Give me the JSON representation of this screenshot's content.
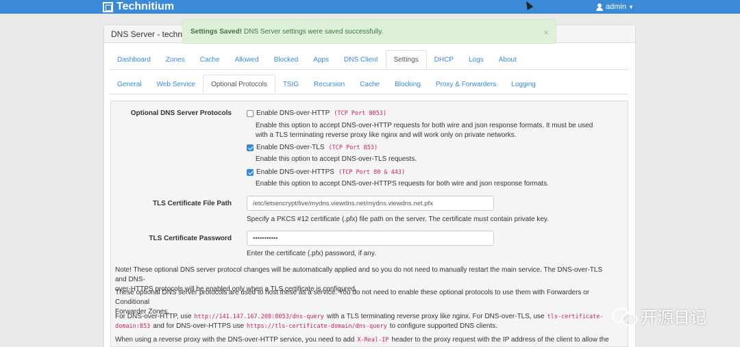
{
  "navbar": {
    "brand": "Technitium",
    "user": "admin"
  },
  "panel": {
    "heading": "DNS Server - techniti"
  },
  "alert": {
    "strong": "Settings Saved!",
    "message": "DNS Server settings were saved successfully.",
    "close": "×"
  },
  "main_tabs": [
    {
      "label": "Dashboard"
    },
    {
      "label": "Zones"
    },
    {
      "label": "Cache"
    },
    {
      "label": "Allowed"
    },
    {
      "label": "Blocked"
    },
    {
      "label": "Apps"
    },
    {
      "label": "DNS Client"
    },
    {
      "label": "Settings"
    },
    {
      "label": "DHCP"
    },
    {
      "label": "Logs"
    },
    {
      "label": "About"
    }
  ],
  "sub_tabs": [
    {
      "label": "General"
    },
    {
      "label": "Web Service"
    },
    {
      "label": "Optional Protocols"
    },
    {
      "label": "TSIG"
    },
    {
      "label": "Recursion"
    },
    {
      "label": "Cache"
    },
    {
      "label": "Blocking"
    },
    {
      "label": "Proxy & Forwarders"
    },
    {
      "label": "Logging"
    }
  ],
  "protocols": {
    "label": "Optional DNS Server Protocols",
    "http": {
      "label": "Enable DNS-over-HTTP",
      "port": "(TCP Port 8053)",
      "checked": false,
      "help1": "Enable this option to accept DNS-over-HTTP requests for both wire and json response formats. It must be used",
      "help2": "with a TLS terminating reverse proxy like nginx and will work only on private networks."
    },
    "tls": {
      "label": "Enable DNS-over-TLS",
      "port": "(TCP Port 853)",
      "checked": true,
      "help": "Enable this option to accept DNS-over-TLS requests."
    },
    "https": {
      "label": "Enable DNS-over-HTTPS",
      "port": "(TCP Port 80 & 443)",
      "checked": true,
      "help": "Enable this option to accept DNS-over-HTTPS requests for both wire and json response formats."
    }
  },
  "cert_path": {
    "label": "TLS Certificate File Path",
    "value": "/etc/letsencrypt/live/mydns.viewdns.net/mydns.viewdns.net.pfx",
    "help": "Specify a PKCS #12 certificate (.pfx) file path on the server. The certificate must contain private key."
  },
  "cert_password": {
    "label": "TLS Certificate Password",
    "value": "•••••••••••",
    "help": "Enter the certificate (.pfx) password, if any."
  },
  "notes": {
    "n1a": "Note! These optional DNS server protocol changes will be automatically applied and so you do not need to manually restart the main service. The DNS-over-TLS and DNS-",
    "n1b": "over-HTTPS protocols will be enabled only when a TLS certificate is configured.",
    "n2a": "These optional DNS server protocols are used to host these as a service. You do not need to enable these optional protocols to use them with Forwarders or Conditional",
    "n2b": "Forwarder Zones.",
    "n3_t1": "For DNS-over-HTTP, use",
    "n3_c1": "http://141.147.167.208:8053/dns-query",
    "n3_t2": "with a TLS terminating reverse proxy like nginx. For DNS-over-TLS, use",
    "n3_c2": "tls-certificate-",
    "n3_c3": "domain:853",
    "n3_t3": "and for DNS-over-HTTPS use",
    "n3_c4": "https://tls-certificate-domain/dns-query",
    "n3_t4": "to configure supported DNS clients.",
    "n4_t1": "When using a reverse proxy with the DNS-over-HTTP service, you need to add",
    "n4_c1": "X-Real-IP",
    "n4_t2": "header to the proxy request with the IP address of the client to allow the DNS"
  },
  "watermark": {
    "text": "开源日记"
  }
}
